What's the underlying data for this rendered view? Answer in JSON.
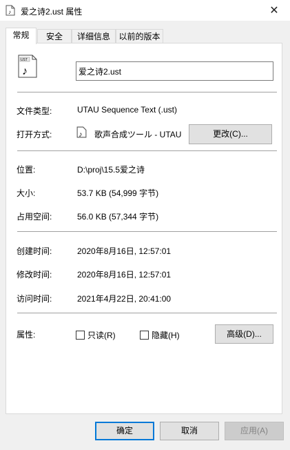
{
  "window": {
    "title": "爱之诗2.ust 属性"
  },
  "tabs": [
    {
      "label": "常规"
    },
    {
      "label": "安全"
    },
    {
      "label": "详细信息"
    },
    {
      "label": "以前的版本"
    }
  ],
  "file": {
    "icon_text": "UST",
    "name": "爱之诗2.ust"
  },
  "type_row": {
    "label": "文件类型:",
    "value": "UTAU Sequence Text (.ust)"
  },
  "open_row": {
    "label": "打开方式:",
    "value": "歌声合成ツール - UTAU",
    "button": "更改(C)..."
  },
  "location_row": {
    "label": "位置:",
    "value": "D:\\proj\\15.5爱之诗"
  },
  "size_row": {
    "label": "大小:",
    "value": "53.7 KB (54,999 字节)"
  },
  "disk_row": {
    "label": "占用空间:",
    "value": "56.0 KB (57,344 字节)"
  },
  "created_row": {
    "label": "创建时间:",
    "value": "2020年8月16日, 12:57:01"
  },
  "modified_row": {
    "label": "修改时间:",
    "value": "2020年8月16日, 12:57:01"
  },
  "accessed_row": {
    "label": "访问时间:",
    "value": "2021年4月22日, 20:41:00"
  },
  "attributes": {
    "label": "属性:",
    "readonly": "只读(R)",
    "hidden": "隐藏(H)",
    "advanced": "高级(D)..."
  },
  "footer": {
    "ok": "确定",
    "cancel": "取消",
    "apply": "应用(A)"
  },
  "icons": {
    "close": "✕",
    "note": "♪"
  }
}
